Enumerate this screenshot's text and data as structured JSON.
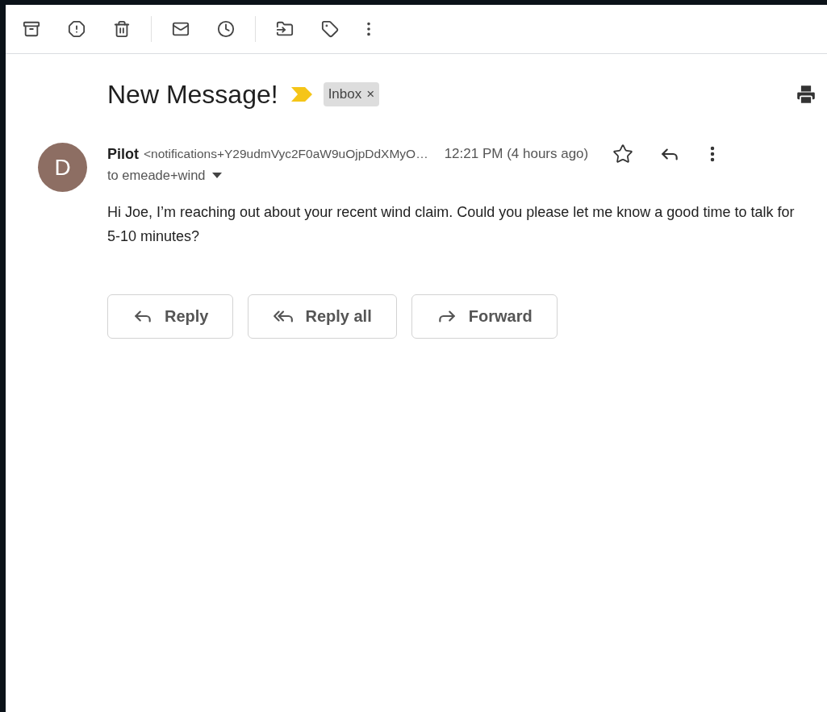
{
  "subject": "New Message!",
  "important": true,
  "labels": [
    {
      "text": "Inbox",
      "removable": "×"
    }
  ],
  "message": {
    "avatar_letter": "D",
    "sender_name": "Pilot",
    "sender_email": "<notifications+Y29udmVyc2F0aW9uOjpDdXMyO…",
    "time": "12:21 PM (4 hours ago)",
    "starred": false,
    "recipient": "to emeade+wind",
    "body": "Hi Joe, I’m reaching out about your recent wind claim. Could you please let me know a good time to talk for 5-10 minutes?"
  },
  "actions": [
    {
      "kind": "reply",
      "label": "Reply"
    },
    {
      "kind": "reply_all",
      "label": "Reply all"
    },
    {
      "kind": "forward",
      "label": "Forward"
    }
  ]
}
